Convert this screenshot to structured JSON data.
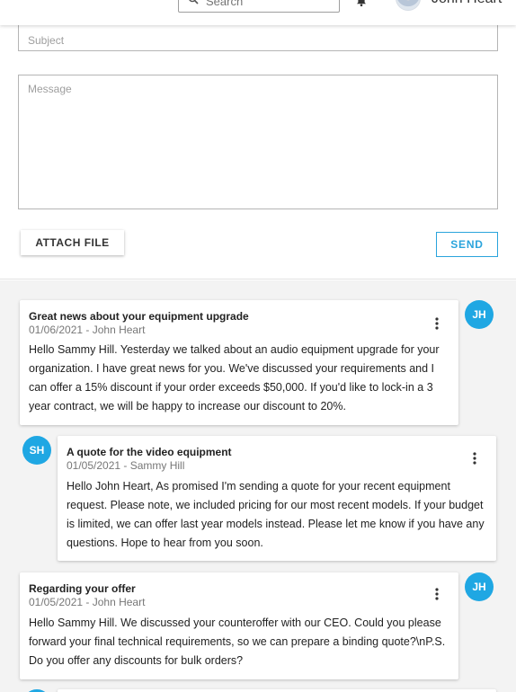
{
  "header": {
    "search_placeholder": "Search",
    "user_name": "John Heart",
    "icons": [
      "search-icon",
      "bell-icon"
    ]
  },
  "compose": {
    "subject_placeholder": "Subject",
    "message_placeholder": "Message",
    "attach_label": "ATTACH FILE",
    "send_label": "SEND"
  },
  "thread": [
    {
      "subject": "Great news about your equipment upgrade",
      "meta": "01/06/2021 - John Heart",
      "initials": "JH",
      "body": "Hello Sammy Hill. Yesterday we talked about an audio equipment upgrade for your organization. I have great news for you. We've discussed your requirements and I can offer a 15% discount if your order exceeds $50,000. If you'd like to lock-in a 3 year contract, we will be happy to increase our discount to 20%."
    },
    {
      "subject": "A quote for the video equipment",
      "meta": "01/05/2021 - Sammy Hill",
      "initials": "SH",
      "body": "Hello John Heart, As promised I'm sending a quote for your recent equipment request. Please note, we included pricing for our most recent models. If your budget is limited, we can offer last year models instead. Please let me know if you have any questions. Hope to hear from you soon."
    },
    {
      "subject": "Regarding your offer",
      "meta": "01/05/2021 - John Heart",
      "initials": "JH",
      "body": "Hello Sammy Hill. We discussed your counteroffer with our CEO. Could you please forward your final technical requirements, so we can prepare a binding quote?\\nP.S. Do you offer any discounts for bulk orders?"
    }
  ],
  "colors": {
    "accent": "#1fa7e3",
    "thread_bg": "#f3f3f3"
  }
}
